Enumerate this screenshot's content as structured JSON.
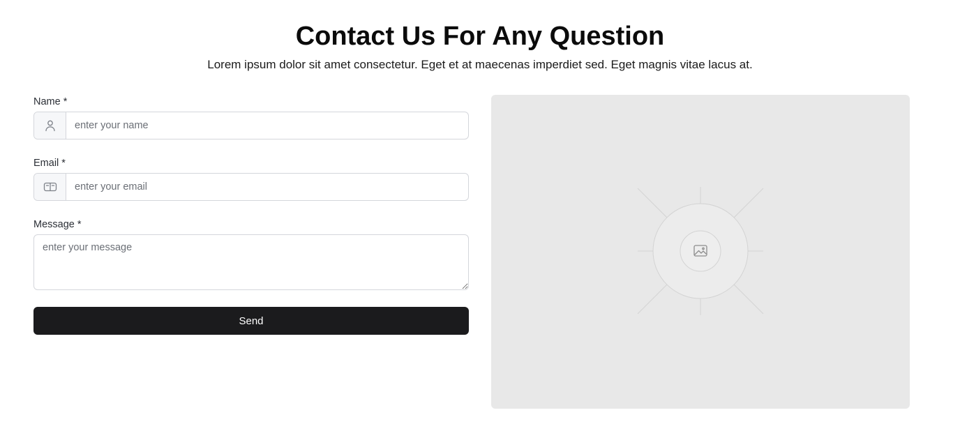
{
  "header": {
    "title": "Contact Us For Any Question",
    "subtitle": "Lorem ipsum dolor sit amet consectetur. Eget et at maecenas imperdiet sed. Eget magnis vitae lacus at."
  },
  "form": {
    "name": {
      "label": "Name *",
      "placeholder": "enter your name",
      "value": "",
      "icon": "user-icon"
    },
    "email": {
      "label": "Email *",
      "placeholder": "enter your email",
      "value": "",
      "icon": "id-card-icon"
    },
    "message": {
      "label": "Message *",
      "placeholder": "enter your message",
      "value": ""
    },
    "submit_label": "Send"
  },
  "media": {
    "icon": "image-icon"
  },
  "colors": {
    "button_bg": "#1b1b1d",
    "placeholder_bg": "#e8e8e8",
    "border": "#d4d6db"
  }
}
